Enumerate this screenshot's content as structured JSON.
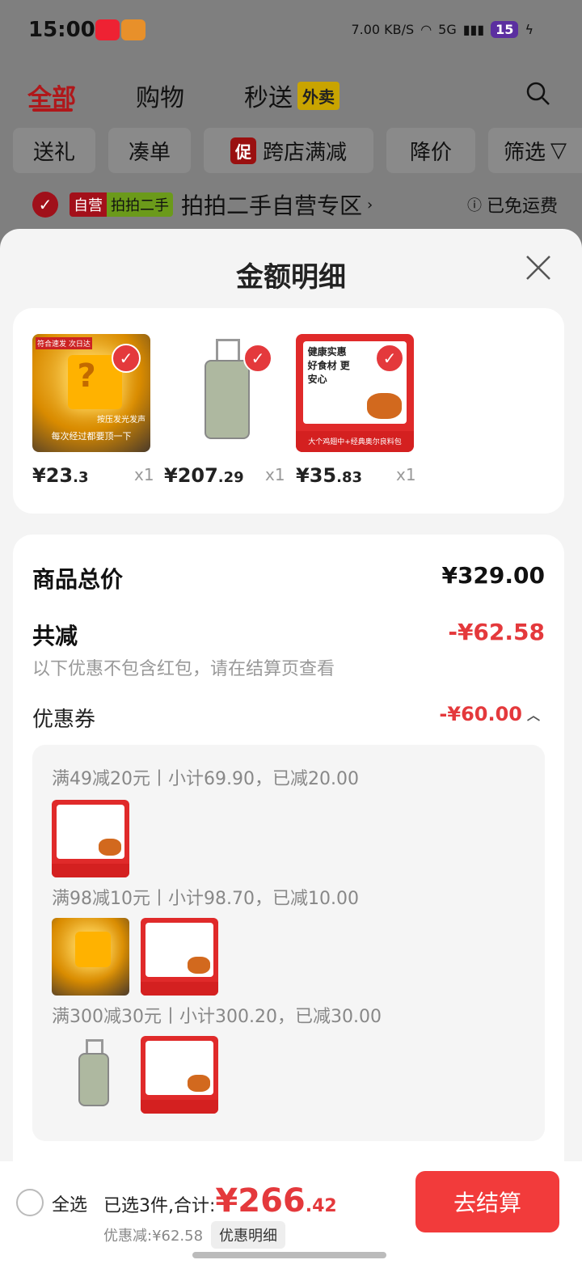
{
  "status_bar": {
    "time": "15:00",
    "speed": "7.00 KB/S",
    "network": "5G",
    "battery": "15"
  },
  "top_tabs": [
    {
      "label": "全部",
      "active": true
    },
    {
      "label": "购物",
      "active": false
    },
    {
      "label": "秒送",
      "active": false
    }
  ],
  "waimai_tag": "外卖",
  "filter_chips": [
    "送礼",
    "凑单",
    "跨店满减",
    "降价",
    "筛选"
  ],
  "promo_tag": "促",
  "store_bar": {
    "tag1": "自营",
    "tag2": "拍拍二手",
    "title": "拍拍二手自营专区",
    "shipping": "已免运费"
  },
  "sheet": {
    "title": "金额明细"
  },
  "products": [
    {
      "name": "lamp",
      "price_int": "¥23",
      "price_dec": ".3",
      "qty": "x1"
    },
    {
      "name": "luggage",
      "price_int": "¥207",
      "price_dec": ".29",
      "qty": "x1"
    },
    {
      "name": "food",
      "price_int": "¥35",
      "price_dec": ".83",
      "qty": "x1"
    }
  ],
  "summary": {
    "total_label": "商品总价",
    "total_value": "¥329.00",
    "discount_label": "共减",
    "discount_value": "-¥62.58",
    "note": "以下优惠不包含红包，请在结算页查看",
    "coupon_label": "优惠券",
    "coupon_value": "-¥60.00"
  },
  "coupon_groups": [
    {
      "text": "满49减20元丨小计69.90，已减20.00"
    },
    {
      "text": "满98减10元丨小计98.70，已减10.00"
    },
    {
      "text": "满300减30元丨小计300.20，已减30.00"
    }
  ],
  "product_art": {
    "lamp_badge": "符合速发 次日达",
    "lamp_hint": "按压发光发声",
    "lamp_caption": "每次经过都要顶一下",
    "food_title": "健康实惠 好食材 更安心",
    "food_bar": "大个鸡翅中+经典奥尔良料包"
  },
  "bottom_bar": {
    "select_all": "全选",
    "selected_text": "已选3件,合计:",
    "total_int": "¥266",
    "total_dec": ".42",
    "discount_text": "优惠减:¥62.58",
    "detail_btn": "优惠明细",
    "checkout": "去结算"
  },
  "colors": {
    "accent": "#e4393c",
    "checkout": "#f23b3b"
  }
}
